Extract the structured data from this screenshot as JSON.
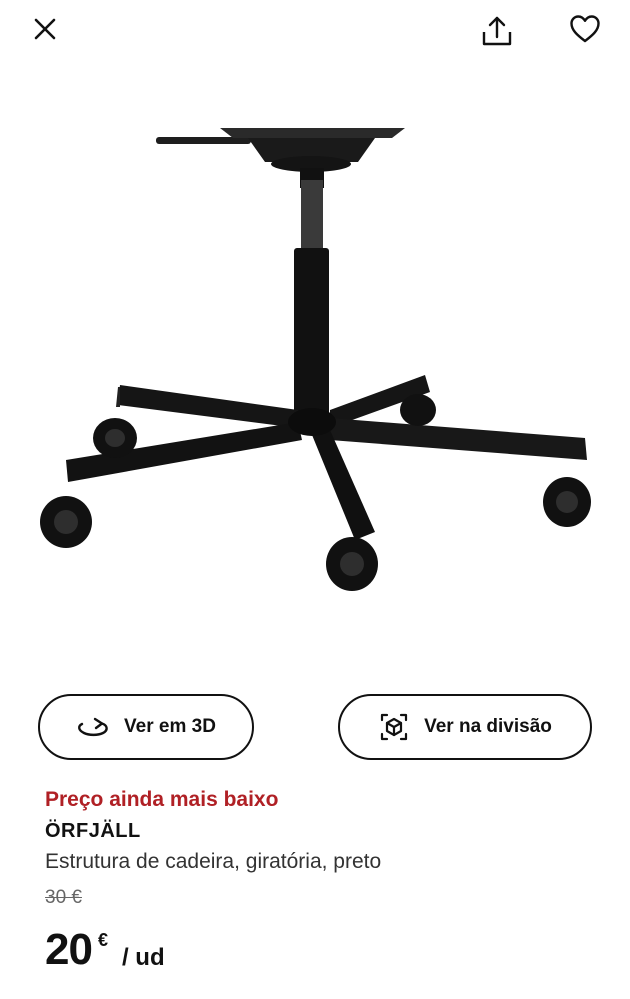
{
  "topbar": {
    "close_icon": "close-icon",
    "share_icon": "share-icon",
    "favorite_icon": "heart-icon"
  },
  "product_image": {
    "subject": "chair-base-image"
  },
  "actions": {
    "view_3d": {
      "label": "Ver em 3D",
      "icon": "rotate-3d-icon"
    },
    "view_room": {
      "label": "Ver na divisão",
      "icon": "augmented-reality-icon"
    }
  },
  "product": {
    "promo": "Preço ainda mais baixo",
    "name": "ÖRFJÄLL",
    "description": "Estrutura de cadeira, giratória, preto",
    "old_price": "30 €",
    "price_integer": "20",
    "price_currency": "€",
    "price_unit": "/ ud"
  },
  "colors": {
    "promo": "#b02025",
    "text": "#111111",
    "muted": "#666666"
  }
}
